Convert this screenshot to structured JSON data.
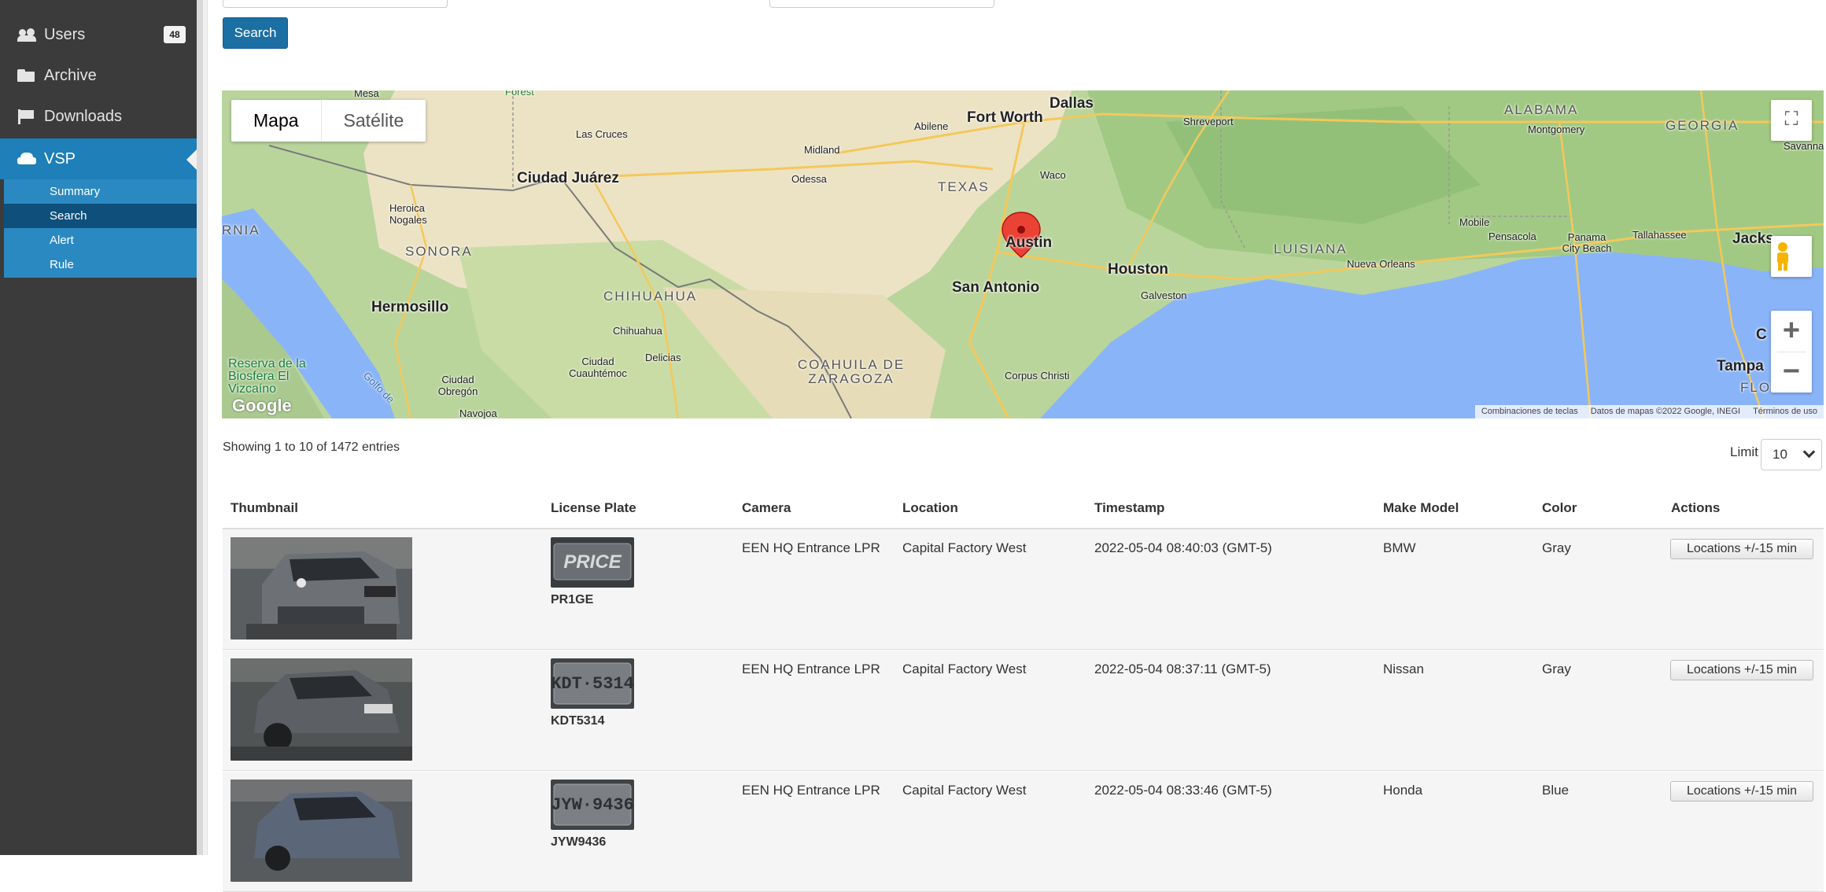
{
  "sidebar": {
    "items": [
      {
        "label": "Users",
        "icon": "users-icon",
        "badge": "48"
      },
      {
        "label": "Archive",
        "icon": "folder-open-icon"
      },
      {
        "label": "Downloads",
        "icon": "flag-icon"
      },
      {
        "label": "VSP",
        "icon": "car-icon"
      }
    ],
    "subitems": [
      "Summary",
      "Search",
      "Alert",
      "Rule"
    ],
    "selected_subitem": "Search"
  },
  "search": {
    "button_label": "Search"
  },
  "map": {
    "tabs": [
      "Mapa",
      "Satélite"
    ],
    "selected_tab": "Mapa",
    "marker_city": "Austin",
    "footer": [
      "Combinaciones de teclas",
      "Datos de mapas ©2022 Google, INEGI",
      "Términos de uso"
    ],
    "logo": "Google",
    "labels": {
      "dallas": "Dallas",
      "fort_worth": "Fort Worth",
      "abilene": "Abilene",
      "shreveport": "Shreveport",
      "alabama": "ALABAMA",
      "montgomery": "Montgomery",
      "georgia": "GEORGIA",
      "savannah": "Savanna",
      "midland": "Midland",
      "odessa": "Odessa",
      "texas": "TEXAS",
      "waco": "Waco",
      "las_cruces": "Las Cruces",
      "ciudad_juarez": "Ciudad Juárez",
      "heroica_nogales": "Heroica Nogales",
      "sonora": "SONORA",
      "rnia": "RNIA",
      "hermosillo": "Hermosillo",
      "chihuahua_state": "CHIHUAHUA",
      "chihuahua_city": "Chihuahua",
      "delicias": "Delicias",
      "cuauhtemoc": "Ciudad Cuauhtémoc",
      "coahuila": "COAHUILA DE ZARAGOZA",
      "san_antonio": "San Antonio",
      "houston": "Houston",
      "galveston": "Galveston",
      "luisiana": "LUISIANA",
      "nueva_orleans": "Nueva Orleans",
      "mobile": "Mobile",
      "pensacola": "Pensacola",
      "panama_city": "Panama City Beach",
      "tallahassee": "Tallahassee",
      "jacksonville": "Jacks",
      "tampa": "Tampa",
      "florida": "FLO",
      "corpus": "Corpus Christi",
      "reserva": "Reserva de la Biosfera El Vizcaíno",
      "obregon": "Ciudad Obregón",
      "navojoa": "Navojoa",
      "golfo": "Golfo de",
      "mesa": "Mesa",
      "forest": "Forest",
      "c": "C"
    }
  },
  "table": {
    "showing": "Showing 1 to 10 of 1472 entries",
    "limit_label": "Limit",
    "limit_value": "10",
    "headers": [
      "Thumbnail",
      "License Plate",
      "Camera",
      "Location",
      "Timestamp",
      "Make Model",
      "Color",
      "Actions"
    ],
    "rows": [
      {
        "plate_text": "PR1GE",
        "plate_image_text": "PRICE",
        "camera": "EEN HQ Entrance LPR",
        "location": "Capital Factory West",
        "timestamp": "2022-05-04 08:40:03 (GMT-5)",
        "make": "BMW",
        "color": "Gray",
        "action": "Locations +/-15 min"
      },
      {
        "plate_text": "KDT5314",
        "plate_image_text": "KDT·5314",
        "camera": "EEN HQ Entrance LPR",
        "location": "Capital Factory West",
        "timestamp": "2022-05-04 08:37:11 (GMT-5)",
        "make": "Nissan",
        "color": "Gray",
        "action": "Locations +/-15 min"
      },
      {
        "plate_text": "JYW9436",
        "plate_image_text": "JYW·9436",
        "camera": "EEN HQ Entrance LPR",
        "location": "Capital Factory West",
        "timestamp": "2022-05-04 08:33:46 (GMT-5)",
        "make": "Honda",
        "color": "Blue",
        "action": "Locations +/-15 min"
      }
    ]
  },
  "colors": {
    "sidebar_bg": "#3b3b3b",
    "accent": "#1f7fb8",
    "sub_selected": "#0f4f7b",
    "gulf": "#8ab4f8",
    "land": "#b5d29a"
  }
}
